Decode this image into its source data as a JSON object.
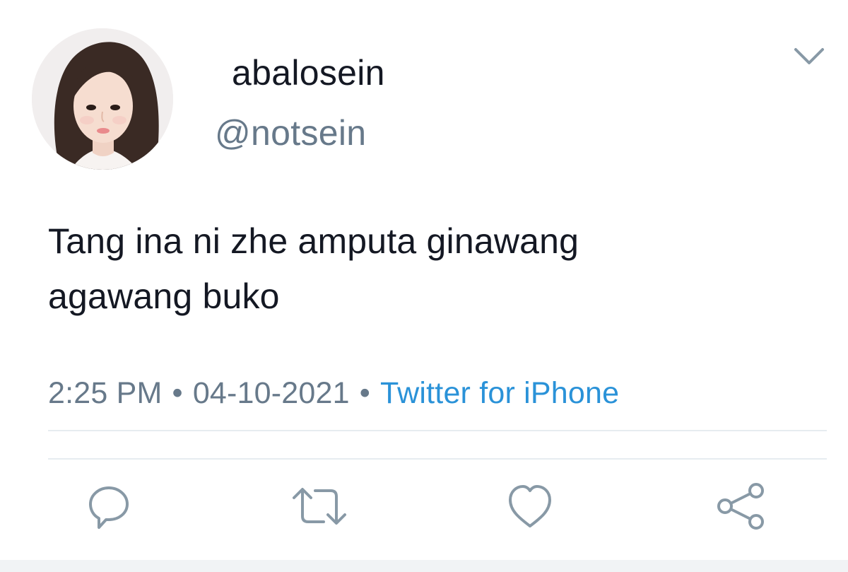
{
  "user": {
    "display_name": "abalosein",
    "handle": "@notsein"
  },
  "tweet": {
    "text_line1": "Tang ina ni zhe amputa ginawang",
    "text_line2": "agawang buko",
    "time": "2:25 PM",
    "date": "04-10-2021",
    "separator": "•",
    "source": "Twitter for iPhone"
  },
  "icons": {
    "menu": "chevron-down-icon",
    "reply": "reply-icon",
    "retweet": "retweet-icon",
    "like": "heart-icon",
    "share": "share-icon"
  },
  "colors": {
    "text": "#141823",
    "secondary": "#67798a",
    "link": "#2a92d8",
    "divider": "#e6ecf0",
    "icon": "#8899a6"
  }
}
